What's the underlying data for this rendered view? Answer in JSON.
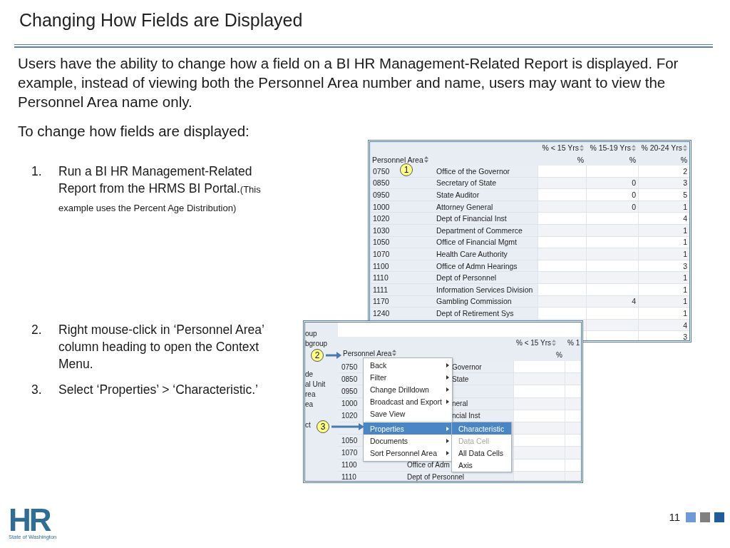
{
  "title": "Changing How Fields are Displayed",
  "intro": "Users have the ability to change how a field on a BI HR Management-Related Report is displayed.  For example, instead of viewing both the Personnel Area number and name, users may want to view the Personnel Area name only.",
  "lead": "To change how fields are displayed:",
  "steps": [
    {
      "number": "1.",
      "text": "Run a BI HR Management-Related Report from the HRMS BI Portal.",
      "note": "(This example uses the Percent Age Distribution)"
    },
    {
      "number": "2.",
      "text": "Right mouse-click in ‘Personnel Area’ column heading to open the Context Menu."
    },
    {
      "number": "3.",
      "text": "Select ‘Properties’ > ‘Characteristic.’"
    }
  ],
  "report_screenshot": {
    "callout": "1",
    "row_header": "Personnel Area",
    "columns": [
      {
        "label": "% < 15 Yrs",
        "unit": "%"
      },
      {
        "label": "% 15-19 Yrs",
        "unit": "%"
      },
      {
        "label": "% 20-24 Yrs",
        "unit": "%"
      }
    ],
    "rows": [
      {
        "code": "0750",
        "name": "Office of the Governor",
        "pct_20_24": "2"
      },
      {
        "code": "0850",
        "name": "Secretary of State",
        "pct_15_19": "0",
        "pct_20_24": "3"
      },
      {
        "code": "0950",
        "name": "State Auditor",
        "pct_15_19": "0",
        "pct_20_24": "5"
      },
      {
        "code": "1000",
        "name": "Attorney General",
        "pct_15_19": "0",
        "pct_20_24": "1"
      },
      {
        "code": "1020",
        "name": "Dept of Financial Inst",
        "pct_20_24": "4"
      },
      {
        "code": "1030",
        "name": "Department of Commerce",
        "pct_20_24": "1"
      },
      {
        "code": "1050",
        "name": "Office of Financial Mgmt",
        "pct_20_24": "1"
      },
      {
        "code": "1070",
        "name": "Health Care Authority",
        "pct_20_24": "1"
      },
      {
        "code": "1100",
        "name": "Office of Admn Hearings",
        "pct_20_24": "3"
      },
      {
        "code": "1110",
        "name": "Dept of Personnel",
        "pct_20_24": "1"
      },
      {
        "code": "1111",
        "name": "Information Services Division",
        "pct_20_24": "1"
      },
      {
        "code": "1170",
        "name": "Gambling Commission",
        "pct_15_19": "4",
        "pct_20_24": "1"
      },
      {
        "code": "1240",
        "name": "Dept of Retirement Sys",
        "pct_20_24": "1"
      },
      {
        "pct_20_24": "4"
      },
      {
        "pct_20_24": "3"
      }
    ]
  },
  "menu_screenshot": {
    "callouts": [
      "2",
      "3"
    ],
    "row_header": "Personnel Area",
    "sidebar_groups": [
      [
        "oup",
        "bgroup"
      ],
      [
        "de",
        "al Unit",
        "rea",
        "ea"
      ],
      [
        "ct"
      ]
    ],
    "columns": [
      {
        "label": "% < 15 Yrs",
        "unit": "%"
      },
      {
        "label": "% 1"
      }
    ],
    "rows": [
      {
        "kind": "partial",
        "code": "0750",
        "name": "Governor"
      },
      {
        "kind": "partial",
        "code": "0850",
        "name": "State"
      },
      {
        "kind": "row",
        "code": "0950"
      },
      {
        "kind": "partial",
        "code": "1000",
        "name": "neral"
      },
      {
        "kind": "partial",
        "code": "1020",
        "name": "ncial Inst"
      },
      {
        "kind": "hidden"
      },
      {
        "kind": "row",
        "code": "1050"
      },
      {
        "kind": "row",
        "code": "1070"
      },
      {
        "kind": "row",
        "code": "1100",
        "name": "Office of Adm"
      },
      {
        "kind": "row",
        "code": "1110",
        "name": "Dept of Personnel"
      }
    ],
    "context_menu": [
      {
        "label": "Back",
        "submenu": true,
        "selected": false,
        "separator_before": false
      },
      {
        "label": "Filter",
        "submenu": true,
        "selected": false,
        "separator_before": false
      },
      {
        "label": "Change Drilldown",
        "submenu": true,
        "selected": false,
        "separator_before": false
      },
      {
        "label": "Broadcast and Export",
        "submenu": true,
        "selected": false,
        "separator_before": false
      },
      {
        "label": "Save View",
        "submenu": false,
        "selected": false,
        "separator_before": false
      },
      {
        "label": "Properties",
        "submenu": true,
        "selected": true,
        "separator_before": true
      },
      {
        "label": "Documents",
        "submenu": true,
        "selected": false,
        "separator_before": false
      },
      {
        "label": "Sort Personnel Area",
        "submenu": true,
        "selected": false,
        "separator_before": false
      }
    ],
    "submenu": [
      {
        "label": "Characteristic",
        "selected": true,
        "disabled": false
      },
      {
        "label": "Data Cell",
        "selected": false,
        "disabled": true
      },
      {
        "label": "All Data Cells",
        "selected": false,
        "disabled": false
      },
      {
        "label": "Axis",
        "selected": false,
        "disabled": false
      }
    ]
  },
  "footer": {
    "logo_letters": "HR",
    "logo_caption": "State of Washington",
    "page_number": "11"
  }
}
